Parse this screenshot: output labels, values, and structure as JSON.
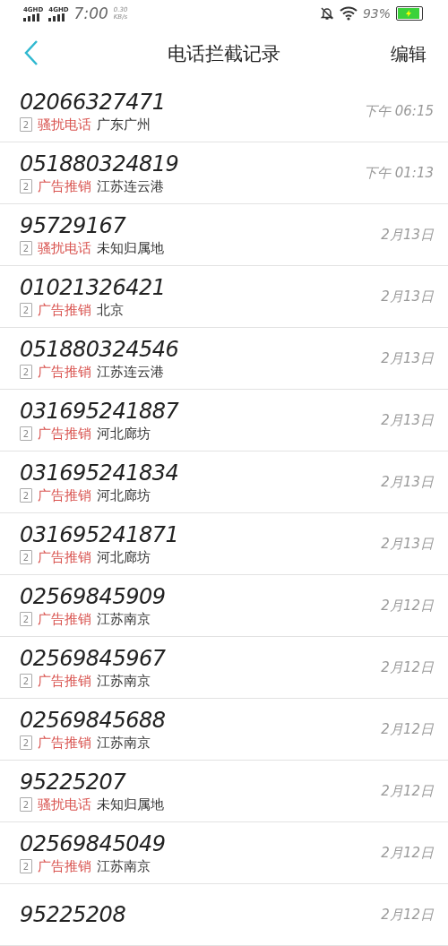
{
  "status_bar": {
    "networks": [
      "4GHD",
      "4GHD"
    ],
    "time": "7:00",
    "speed": "0.30",
    "speed_unit": "KB/s",
    "battery_text": "93%",
    "battery": {
      "level": 0.93,
      "charging": true
    }
  },
  "nav": {
    "title": "电话拦截记录",
    "action": "编辑"
  },
  "records": [
    {
      "number": "02066327471",
      "sim": "2",
      "tag": "骚扰电话",
      "location": "广东广州",
      "time": "下午 06:15"
    },
    {
      "number": "051880324819",
      "sim": "2",
      "tag": "广告推销",
      "location": "江苏连云港",
      "time": "下午 01:13"
    },
    {
      "number": "95729167",
      "sim": "2",
      "tag": "骚扰电话",
      "location": "未知归属地",
      "time": "2月13日"
    },
    {
      "number": "01021326421",
      "sim": "2",
      "tag": "广告推销",
      "location": "北京",
      "time": "2月13日"
    },
    {
      "number": "051880324546",
      "sim": "2",
      "tag": "广告推销",
      "location": "江苏连云港",
      "time": "2月13日"
    },
    {
      "number": "031695241887",
      "sim": "2",
      "tag": "广告推销",
      "location": "河北廊坊",
      "time": "2月13日"
    },
    {
      "number": "031695241834",
      "sim": "2",
      "tag": "广告推销",
      "location": "河北廊坊",
      "time": "2月13日"
    },
    {
      "number": "031695241871",
      "sim": "2",
      "tag": "广告推销",
      "location": "河北廊坊",
      "time": "2月13日"
    },
    {
      "number": "02569845909",
      "sim": "2",
      "tag": "广告推销",
      "location": "江苏南京",
      "time": "2月12日"
    },
    {
      "number": "02569845967",
      "sim": "2",
      "tag": "广告推销",
      "location": "江苏南京",
      "time": "2月12日"
    },
    {
      "number": "02569845688",
      "sim": "2",
      "tag": "广告推销",
      "location": "江苏南京",
      "time": "2月12日"
    },
    {
      "number": "95225207",
      "sim": "2",
      "tag": "骚扰电话",
      "location": "未知归属地",
      "time": "2月12日"
    },
    {
      "number": "02569845049",
      "sim": "2",
      "tag": "广告推销",
      "location": "江苏南京",
      "time": "2月12日"
    },
    {
      "number": "95225208",
      "time": "2月12日"
    }
  ]
}
